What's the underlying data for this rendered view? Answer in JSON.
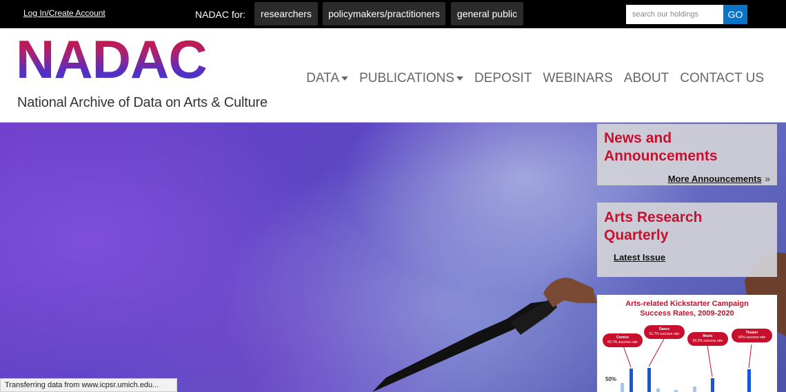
{
  "topbar": {
    "login_label": "Log In/Create Account",
    "nadac_for_label": "NADAC for:",
    "audiences": [
      "researchers",
      "policymakers/practitioners",
      "general public"
    ],
    "search_placeholder": "search our holdings",
    "go_label": "GO"
  },
  "header": {
    "logo_text": "NADAC",
    "tagline": "National Archive of Data on Arts & Culture",
    "nav": [
      {
        "label": "DATA",
        "dropdown": true
      },
      {
        "label": "PUBLICATIONS",
        "dropdown": true
      },
      {
        "label": "DEPOSIT",
        "dropdown": false
      },
      {
        "label": "WEBINARS",
        "dropdown": false
      },
      {
        "label": "ABOUT",
        "dropdown": false
      },
      {
        "label": "CONTACT US",
        "dropdown": false
      }
    ]
  },
  "sidebar": {
    "news": {
      "title_line1": "News and",
      "title_line2": "Announcements",
      "link": "More Announcements"
    },
    "arq": {
      "title_line1": "Arts Research",
      "title_line2": "Quarterly",
      "link": "Latest Issue"
    },
    "chart_card": {
      "title_line1": "Arts-related Kickstarter Campaign",
      "title_line2": "Success Rates, 2009-2020",
      "y_label": "50%",
      "bubbles": [
        {
          "name": "Comics",
          "rate": "60.7% success rate"
        },
        {
          "name": "Dance",
          "rate": "61.7% success rate"
        },
        {
          "name": "Music",
          "rate": "50.2% success rate"
        },
        {
          "name": "Theater",
          "rate": "60% success rate"
        }
      ]
    }
  },
  "status_bar": "Transferring data from www.icpsr.umich.edu..."
}
